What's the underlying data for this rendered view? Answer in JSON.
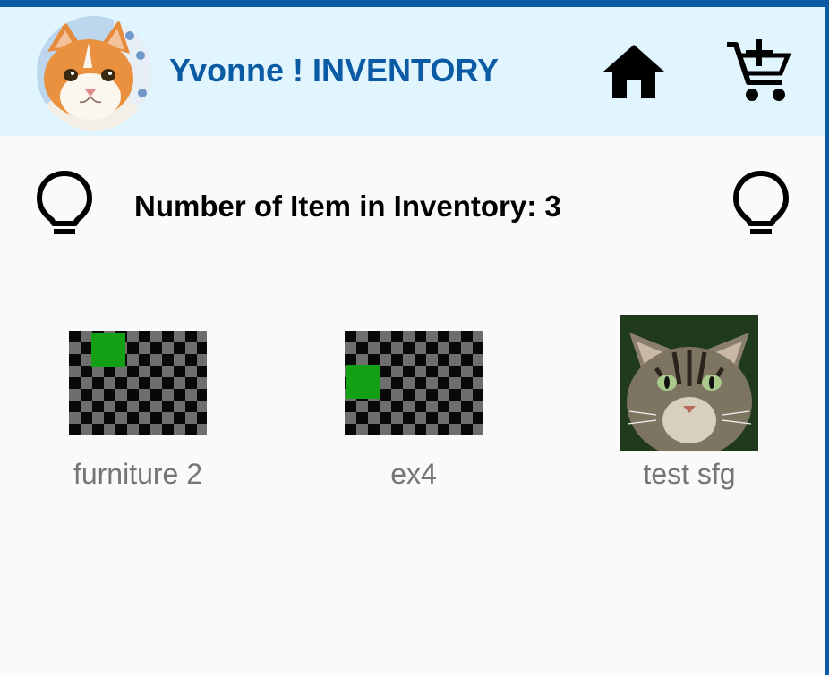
{
  "header": {
    "title": "Yvonne ! INVENTORY",
    "avatar_icon": "cat-avatar-photo",
    "home_icon": "home-icon",
    "cart_icon": "add-to-cart-icon",
    "background_color": "#e1f5fe",
    "title_color": "#0a5aa4"
  },
  "summary": {
    "count_text": "Number of Item in Inventory: 3",
    "left_icon": "lightbulb-icon",
    "right_icon": "lightbulb-icon"
  },
  "items": [
    {
      "name": "furniture 2",
      "thumbnail": "checkerboard-placeholder"
    },
    {
      "name": "ex4",
      "thumbnail": "checkerboard-placeholder"
    },
    {
      "name": "test sfg",
      "thumbnail": "cat-photo"
    }
  ],
  "colors": {
    "accent": "#0a5aa4",
    "placeholder_green": "#14a014",
    "item_text": "#757575"
  }
}
